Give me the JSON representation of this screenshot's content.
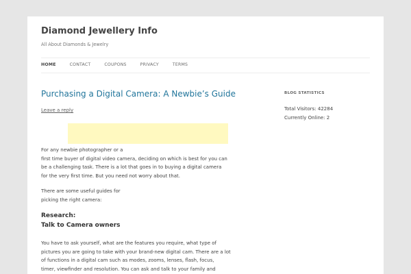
{
  "site": {
    "title": "Diamond Jewellery Info",
    "description": "All About Diamonds & Jewelry"
  },
  "nav": {
    "items": [
      "HOME",
      "CONTACT",
      "COUPONS",
      "PRIVACY",
      "TERMS"
    ],
    "active": "HOME"
  },
  "post": {
    "title": "Purchasing a Digital Camera: A Newbie’s Guide",
    "leave_reply": "Leave a reply",
    "para1": [
      "For any newbie photographer or a",
      "first time buyer of digital video camera, deciding on which is best for you can",
      "be a challenging task. There is a lot that goes in to buying a digital camera",
      "for the very first time. But you need not worry about that."
    ],
    "para2": [
      "There are some useful guides for",
      "picking the right camera:"
    ],
    "research_heading": "Research:",
    "subheading": "Talk to Camera owners",
    "para3": [
      "You have to ask yourself, what are the features you require, what type of",
      "pictures you are going to take with your brand-new digital cam. There are a lot",
      "of functions in a digital cam such as modes, zooms, lenses, flash, focus,",
      "timer, viewfinder and resolution. You can ask and talk to your family and"
    ]
  },
  "sidebar": {
    "widget_title": "BLOG STATISTICS",
    "total_visitors": "Total Visitors: 42284",
    "currently_online": "Currently Online: 2"
  },
  "colors": {
    "background": "#e6e6e6",
    "link_blue": "#21759b",
    "ad_yellow": "#fff9c0"
  }
}
